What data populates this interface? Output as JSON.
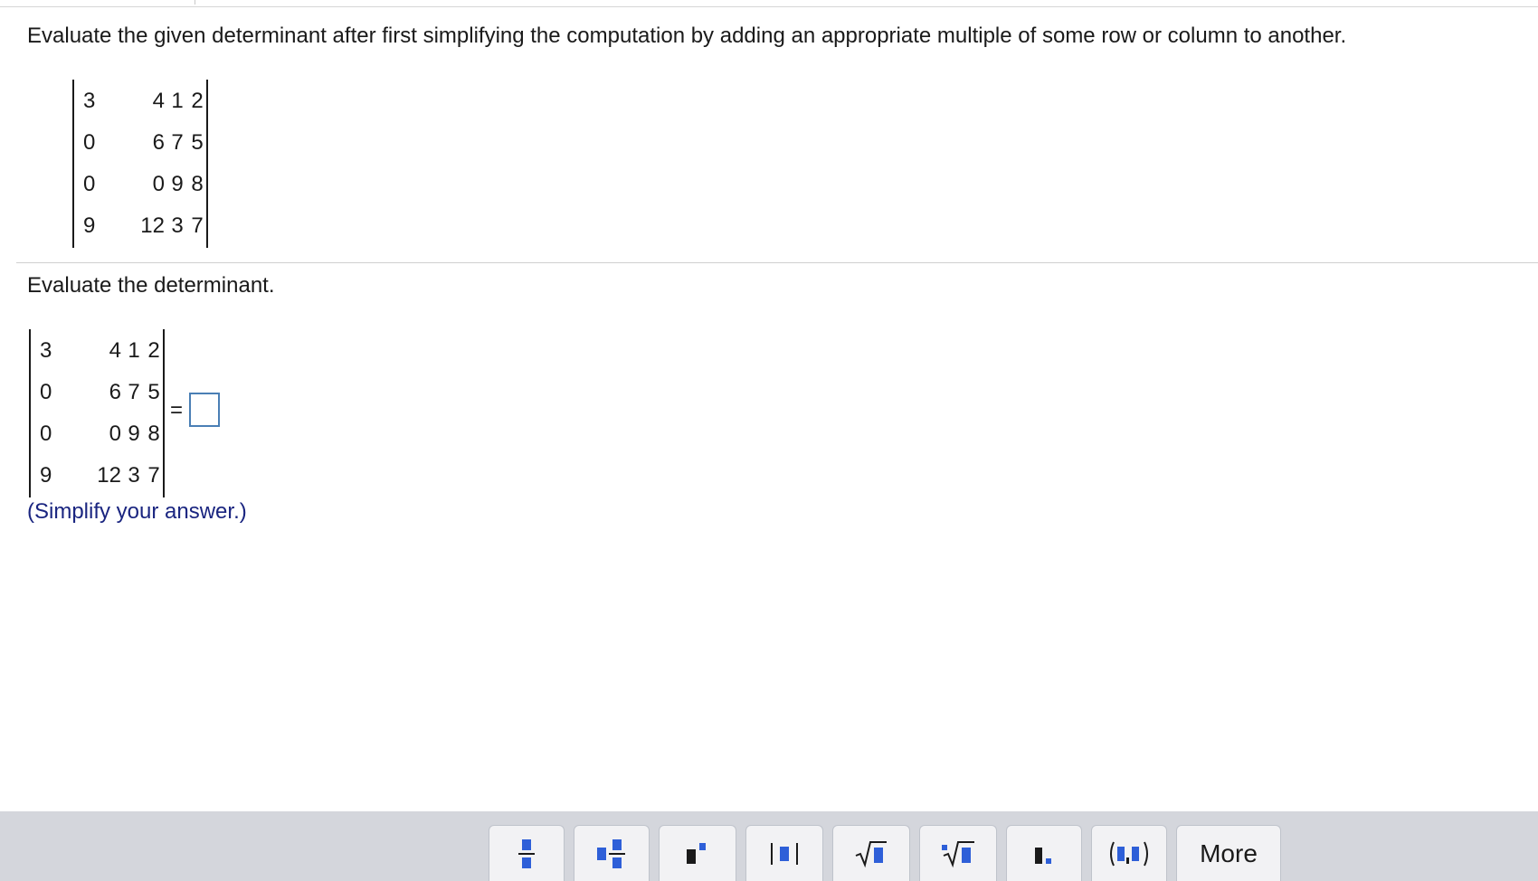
{
  "instructions": "Evaluate the given determinant after first simplifying the computation by adding an appropriate multiple of some row or column to another.",
  "matrix": [
    [
      "3",
      "4",
      "1",
      "2"
    ],
    [
      "0",
      "6",
      "7",
      "5"
    ],
    [
      "0",
      "0",
      "9",
      "8"
    ],
    [
      "9",
      "12",
      "3",
      "7"
    ]
  ],
  "prompt": "Evaluate the determinant.",
  "equals_sign": "=",
  "answer_value": "",
  "hint": "(Simplify your answer.)",
  "toolbar": {
    "tools": [
      {
        "icon": "fraction-icon"
      },
      {
        "icon": "mixed-number-icon"
      },
      {
        "icon": "exponent-icon"
      },
      {
        "icon": "absolute-value-icon"
      },
      {
        "icon": "square-root-icon"
      },
      {
        "icon": "nth-root-icon"
      },
      {
        "icon": "decimal-icon"
      },
      {
        "icon": "ordered-pair-icon"
      }
    ],
    "more_label": "More"
  },
  "colors": {
    "answer_border": "#4a7fb5",
    "hint_text": "#1a2580",
    "icon_blue": "#2e5fd8",
    "toolbar_bg": "#d4d6dc"
  }
}
